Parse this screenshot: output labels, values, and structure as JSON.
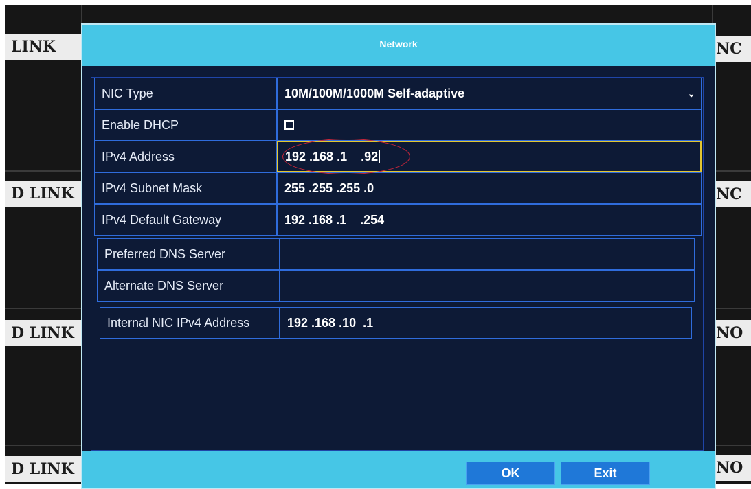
{
  "background": {
    "no_link_labels": [
      "LINK",
      "D LINK",
      "D LINK",
      "D LINK",
      "NC",
      "NC",
      "NO",
      "NO"
    ]
  },
  "dialog": {
    "title": "Network",
    "fields": [
      {
        "label": "NIC Type",
        "value": "10M/100M/1000M Self-adaptive",
        "control": "dropdown"
      },
      {
        "label": "Enable DHCP",
        "value": "",
        "control": "checkbox",
        "checked": false
      },
      {
        "label": "IPv4 Address",
        "value": "192 .168 .1    .92",
        "control": "ip",
        "selected": true
      },
      {
        "label": "IPv4 Subnet Mask",
        "value": "255 .255 .255 .0",
        "control": "ip"
      },
      {
        "label": "IPv4 Default Gateway",
        "value": "192 .168 .1    .254",
        "control": "ip"
      },
      {
        "label": "Preferred DNS Server",
        "value": "",
        "control": "ip"
      },
      {
        "label": "Alternate DNS Server",
        "value": "",
        "control": "ip"
      },
      {
        "label": "Internal NIC IPv4 Address",
        "value": "192 .168 .10  .1",
        "control": "ip"
      }
    ],
    "buttons": {
      "ok": "OK",
      "exit": "Exit"
    }
  },
  "colors": {
    "title_bar": "#46c6e6",
    "panel_bg": "#0d1a36",
    "cell_border": "#2f6cdc",
    "selected_border": "#e2c630",
    "button": "#1f78d8",
    "annotation": "#c8263a"
  },
  "icons": {
    "dropdown": "chevron-down-icon",
    "checkbox": "checkbox-icon",
    "pointer": "mouse-pointer-icon"
  }
}
